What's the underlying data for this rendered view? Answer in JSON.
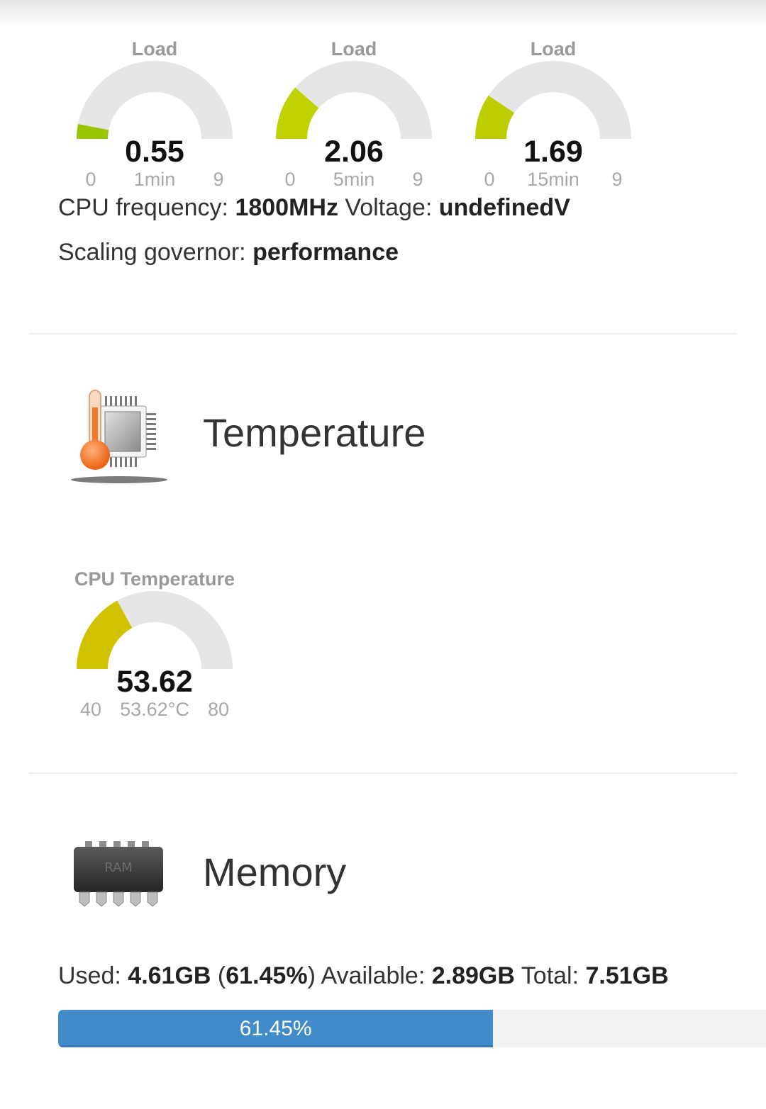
{
  "load": {
    "gauges": [
      {
        "title": "Load",
        "value": "0.55",
        "min": "0",
        "max": "9",
        "label": "1min",
        "level": 0.0611,
        "color": "#99c400"
      },
      {
        "title": "Load",
        "value": "2.06",
        "min": "0",
        "max": "9",
        "label": "5min",
        "level": 0.2289,
        "color": "#c0d200"
      },
      {
        "title": "Load",
        "value": "1.69",
        "min": "0",
        "max": "9",
        "label": "15min",
        "level": 0.1878,
        "color": "#bccd00"
      }
    ],
    "cpu_frequency_label": "CPU frequency:",
    "cpu_frequency_value": "1800MHz",
    "voltage_label": "Voltage:",
    "voltage_value": "undefinedV",
    "governor_label": "Scaling governor:",
    "governor_value": "performance"
  },
  "temperature": {
    "section_title": "Temperature",
    "icon": "cpu-thermometer-icon",
    "gauge": {
      "title": "CPU Temperature",
      "value": "53.62",
      "min": "40",
      "max": "80",
      "label": "53.62°C",
      "level": 0.3405,
      "color": "#d1c200"
    }
  },
  "memory": {
    "section_title": "Memory",
    "icon": "ram-chip-icon",
    "used_label": "Used:",
    "used_value": "4.61GB",
    "used_percent_text": "61.45%",
    "available_label": "Available:",
    "available_value": "2.89GB",
    "total_label": "Total:",
    "total_value": "7.51GB",
    "progress_text": "61.45%",
    "progress_fraction": 0.6145,
    "progress_color": "#428bca"
  }
}
